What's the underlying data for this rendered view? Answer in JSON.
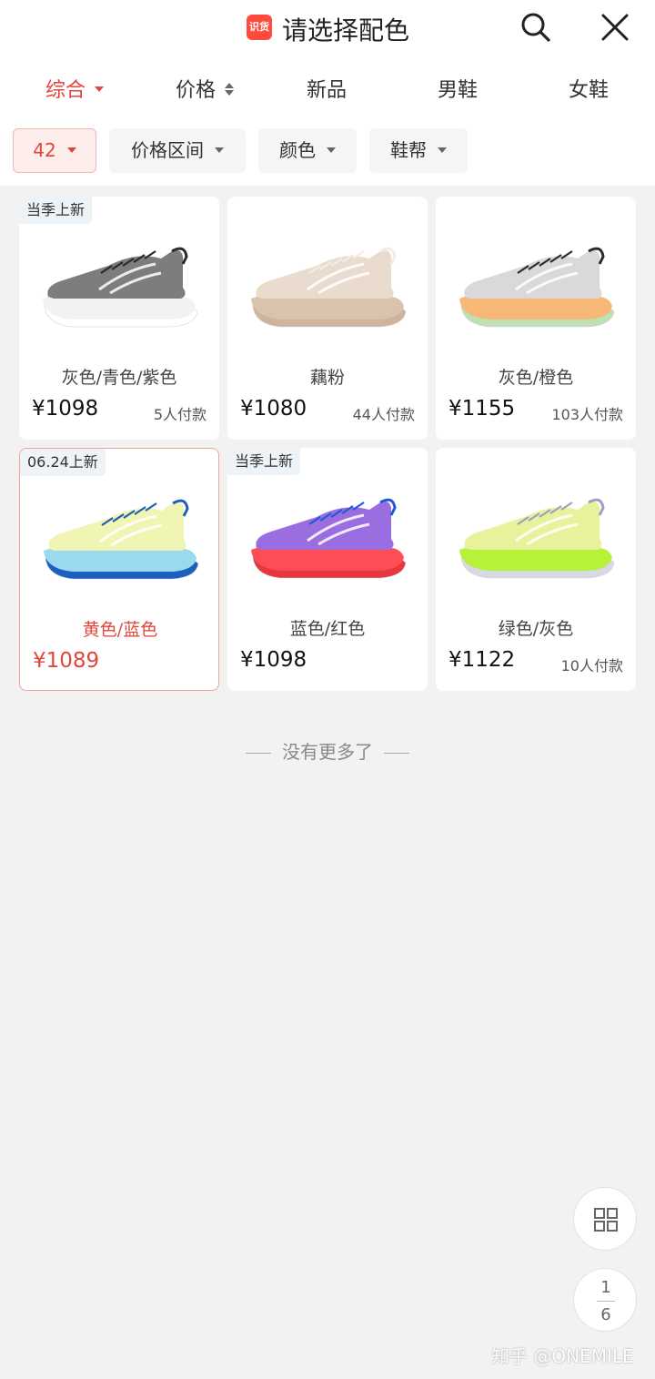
{
  "header": {
    "logo_text": "识货",
    "title": "请选择配色",
    "search_icon": "search-icon",
    "close_icon": "close-icon"
  },
  "sort_tabs": [
    {
      "label": "综合",
      "active": true,
      "indicator": "triangle-down"
    },
    {
      "label": "价格",
      "active": false,
      "indicator": "sort-updown"
    },
    {
      "label": "新品",
      "active": false
    },
    {
      "label": "男鞋",
      "active": false
    },
    {
      "label": "女鞋",
      "active": false
    }
  ],
  "filters": [
    {
      "label": "42",
      "active": true
    },
    {
      "label": "价格区间",
      "active": false
    },
    {
      "label": "颜色",
      "active": false
    },
    {
      "label": "鞋帮",
      "active": false
    }
  ],
  "products": [
    {
      "tag": "当季上新",
      "color_name": "灰色/青色/紫色",
      "price": "¥1098",
      "buyers": "5人付款",
      "selected": false,
      "palette": {
        "upper": "#7d7d80",
        "mid": "#f2f2f2",
        "sole": "#ffffff",
        "accent": "#2a2a2a"
      }
    },
    {
      "tag": "",
      "color_name": "藕粉",
      "price": "¥1080",
      "buyers": "44人付款",
      "selected": false,
      "palette": {
        "upper": "#eadbcf",
        "mid": "#d9c3ad",
        "sole": "#cdb49b",
        "accent": "#f5ece4"
      }
    },
    {
      "tag": "",
      "color_name": "灰色/橙色",
      "price": "¥1155",
      "buyers": "103人付款",
      "selected": false,
      "palette": {
        "upper": "#d9d9d9",
        "mid": "#f7b877",
        "sole": "#bfe0b5",
        "accent": "#2b2b2b"
      }
    },
    {
      "tag": "06.24上新",
      "color_name": "黄色/蓝色",
      "price": "¥1089",
      "buyers": "",
      "selected": true,
      "palette": {
        "upper": "#f0f5b3",
        "mid": "#9ad9ee",
        "sole": "#1d5fbf",
        "accent": "#1d5fbf"
      }
    },
    {
      "tag": "当季上新",
      "color_name": "蓝色/红色",
      "price": "¥1098",
      "buyers": "",
      "selected": false,
      "palette": {
        "upper": "#9a6ee0",
        "mid": "#ff4d57",
        "sole": "#e8363f",
        "accent": "#1f59d9"
      }
    },
    {
      "tag": "",
      "color_name": "绿色/灰色",
      "price": "¥1122",
      "buyers": "10人付款",
      "selected": false,
      "palette": {
        "upper": "#e8f29a",
        "mid": "#b7f23a",
        "sole": "#d7d9e6",
        "accent": "#9ea0c0"
      }
    }
  ],
  "end_note": "没有更多了",
  "float_buttons": {
    "grid_icon": "grid-view-icon",
    "page_current": "1",
    "page_total": "6"
  },
  "watermark": "知乎 @ONEMILE",
  "colors": {
    "accent": "#e0463a",
    "background": "#f2f2f2",
    "card": "#ffffff",
    "logo": "#ff4a3d"
  }
}
